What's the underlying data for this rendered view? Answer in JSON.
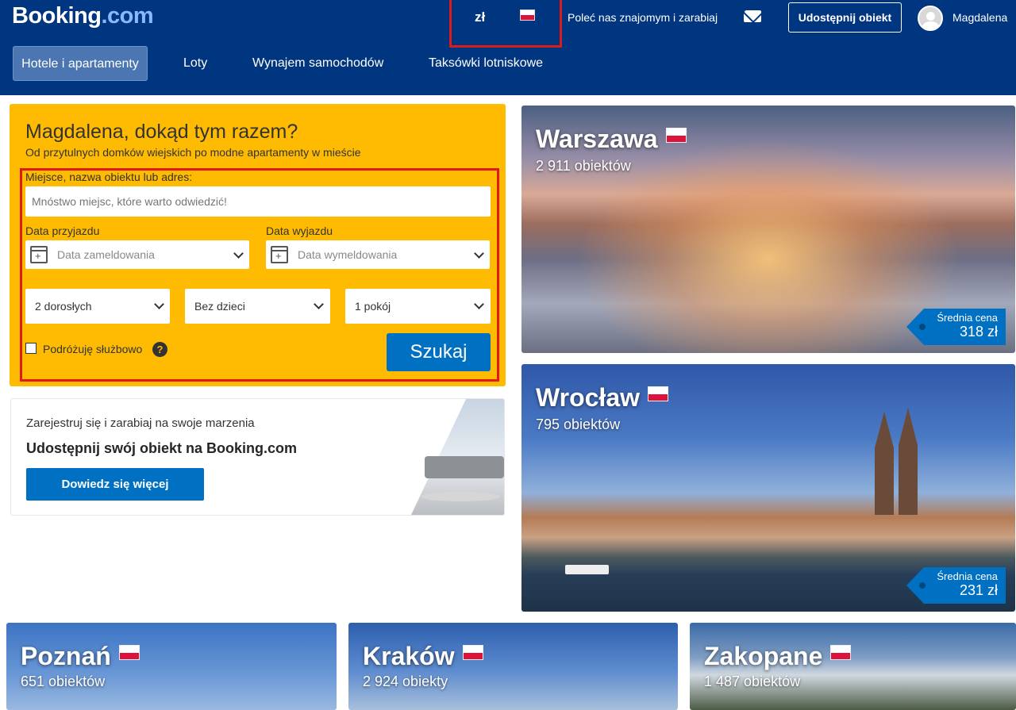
{
  "header": {
    "logo_main": "Booking",
    "logo_suffix": ".com",
    "currency": "zł",
    "refer": "Poleć nas znajomym i zarabiaj",
    "list_property": "Udostępnij obiekt",
    "username": "Magdalena"
  },
  "nav": {
    "items": [
      "Hotele i apartamenty",
      "Loty",
      "Wynajem samochodów",
      "Taksówki lotniskowe"
    ]
  },
  "search": {
    "title": "Magdalena, dokąd tym razem?",
    "subtitle": "Od przytulnych domków wiejskich po modne apartamenty w mieście",
    "destination_label": "Miejsce, nazwa obiektu lub adres:",
    "destination_placeholder": "Mnóstwo miejsc, które warto odwiedzić!",
    "checkin_label": "Data przyjazdu",
    "checkin_value": "Data zameldowania",
    "checkout_label": "Data wyjazdu",
    "checkout_value": "Data wymeldowania",
    "adults": "2 dorosłych",
    "children": "Bez dzieci",
    "rooms": "1 pokój",
    "business": "Podróżuję służbowo",
    "help": "?",
    "button": "Szukaj"
  },
  "promo": {
    "subtitle": "Zarejestruj się i zarabiaj na swoje marzenia",
    "title": "Udostępnij swój obiekt na Booking.com",
    "button": "Dowiedz się więcej"
  },
  "cities": {
    "warsaw": {
      "name": "Warszawa",
      "count": "2 911 obiektów",
      "price_label": "Średnia cena",
      "price": "318 zł"
    },
    "wroclaw": {
      "name": "Wrocław",
      "count": "795 obiektów",
      "price_label": "Średnia cena",
      "price": "231 zł"
    },
    "poznan": {
      "name": "Poznań",
      "count": "651 obiektów"
    },
    "krakow": {
      "name": "Kraków",
      "count": "2 924 obiekty"
    },
    "zakopane": {
      "name": "Zakopane",
      "count": "1 487 obiektów"
    }
  },
  "colors": {
    "brand_blue": "#003580",
    "search_yellow": "#febb02",
    "action_blue": "#0071c2",
    "highlight_red": "#e01a1a"
  }
}
